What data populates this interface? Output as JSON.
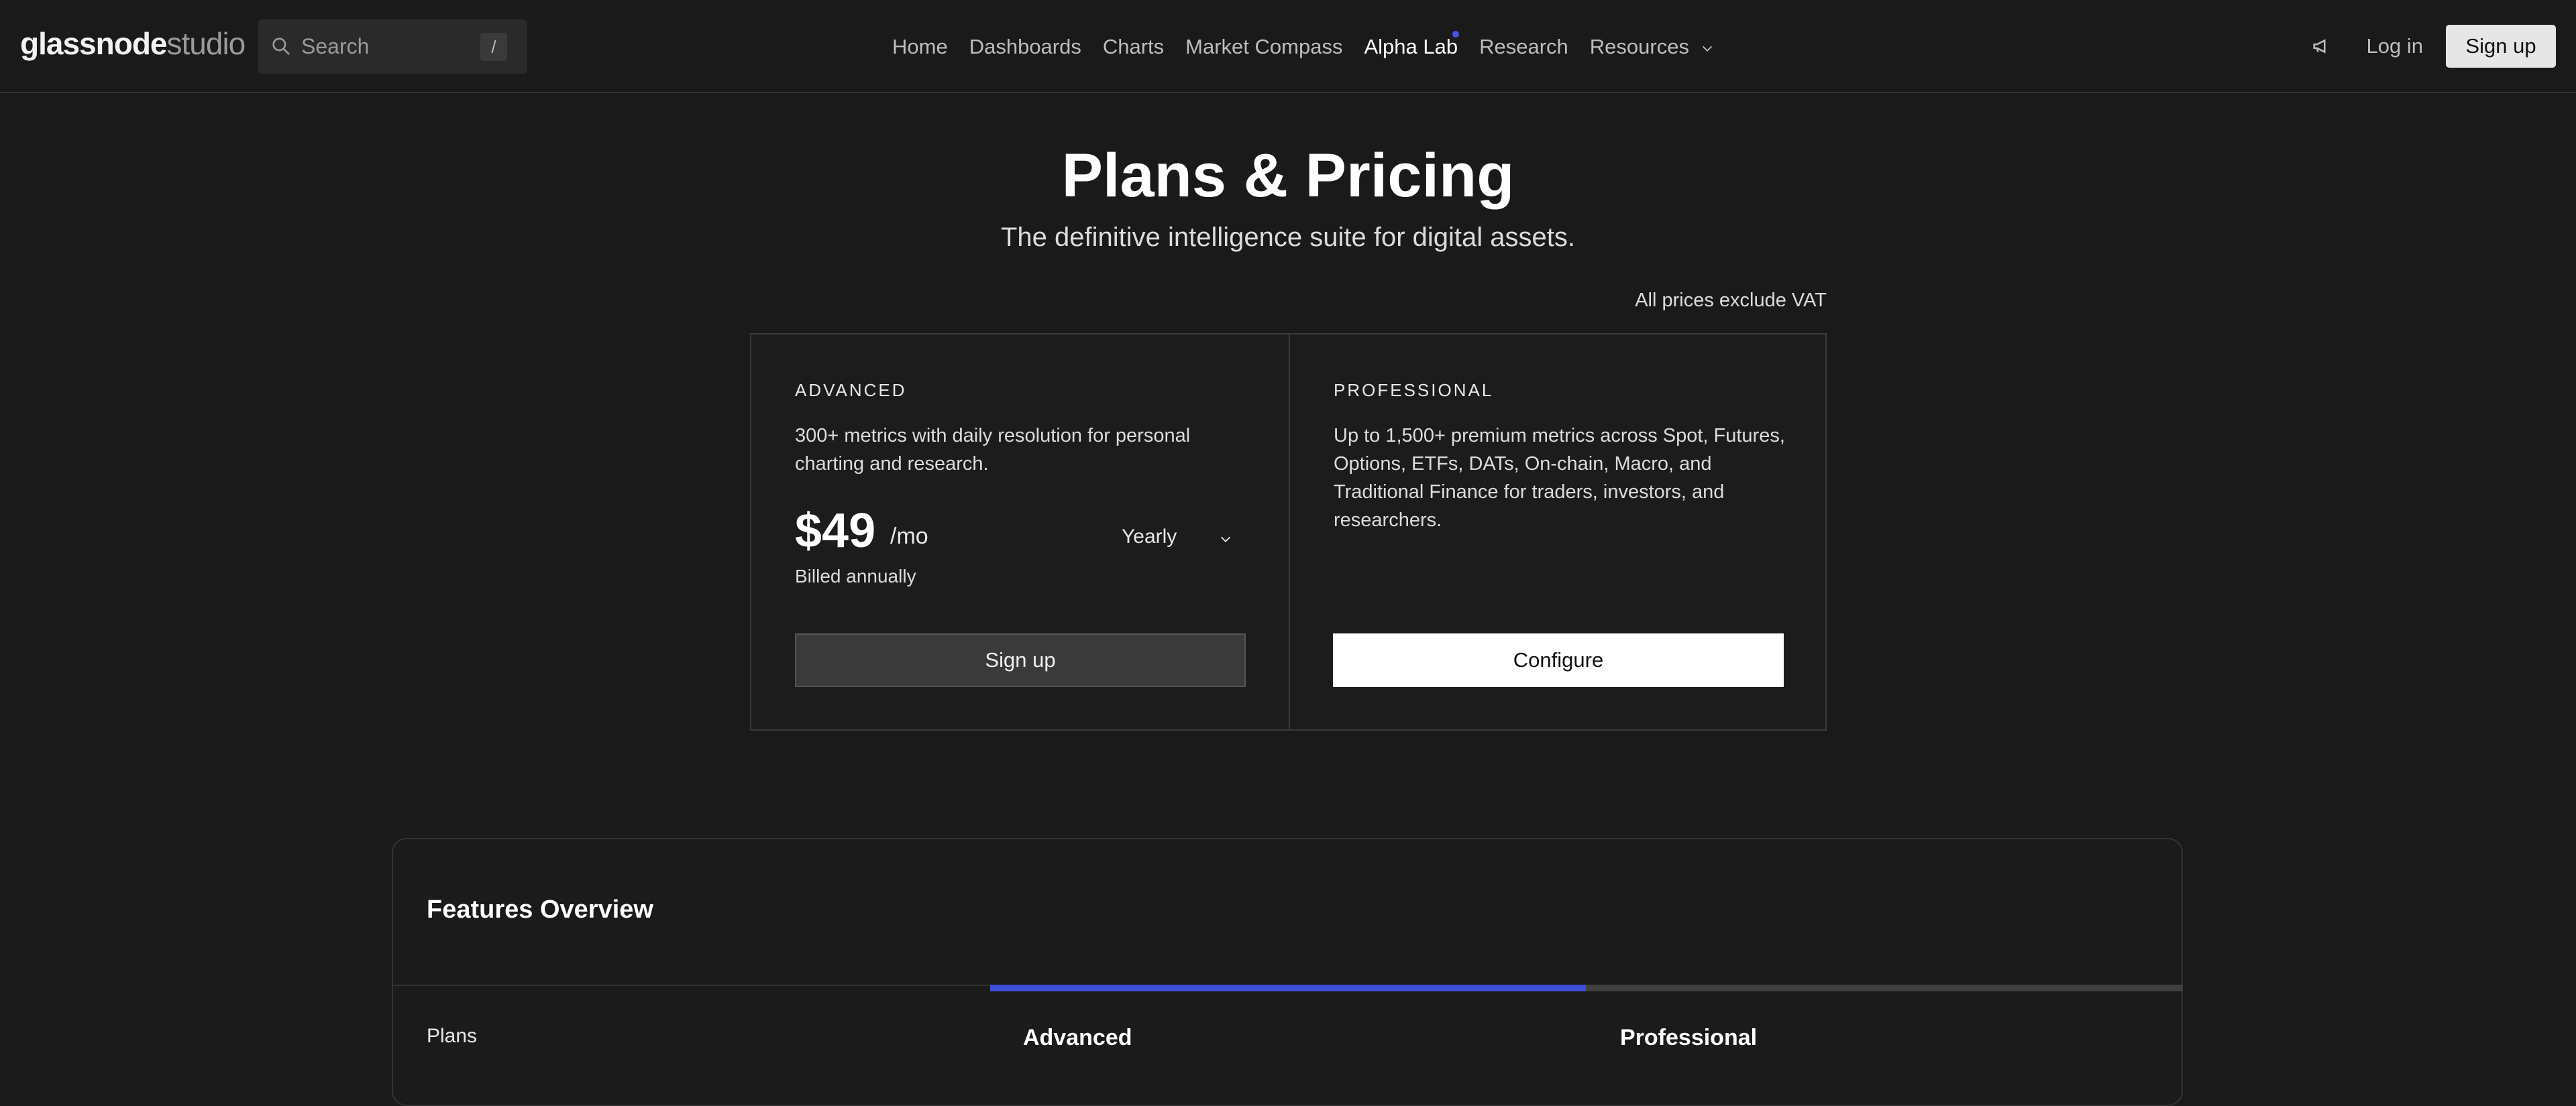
{
  "header": {
    "logo": {
      "primary": "glassnode",
      "secondary": "studio"
    },
    "search": {
      "placeholder": "Search",
      "shortcut": "/"
    },
    "nav": [
      {
        "label": "Home"
      },
      {
        "label": "Dashboards"
      },
      {
        "label": "Charts"
      },
      {
        "label": "Market Compass"
      },
      {
        "label": "Alpha Lab",
        "active": true,
        "indicator": true
      },
      {
        "label": "Research"
      },
      {
        "label": "Resources",
        "has_dropdown": true
      }
    ],
    "login_label": "Log in",
    "signup_label": "Sign up",
    "icons": {
      "search": "search-icon",
      "announcement": "megaphone-icon",
      "dropdown": "chevron-down-icon"
    }
  },
  "hero": {
    "title": "Plans & Pricing",
    "subtitle": "The definitive intelligence suite for digital assets.",
    "vat_note": "All prices exclude VAT"
  },
  "plans": {
    "advanced": {
      "label": "ADVANCED",
      "description": "300+ metrics with daily resolution for personal charting and research.",
      "price": "$49",
      "price_unit": "/mo",
      "billing_period": "Yearly",
      "billing_note": "Billed annually",
      "cta": "Sign up"
    },
    "professional": {
      "label": "PROFESSIONAL",
      "description": "Up to 1,500+ premium metrics across Spot, Futures, Options, ETFs, DATs, On-chain, Macro, and Traditional Finance for traders, investors, and researchers.",
      "cta": "Configure"
    }
  },
  "features": {
    "title": "Features Overview",
    "row_label": "Plans",
    "columns": [
      "Advanced",
      "Professional"
    ],
    "active_column": "Advanced"
  },
  "colors": {
    "background": "#1a1a1a",
    "accent": "#3f4fd6",
    "text": "#e8e8e8"
  }
}
